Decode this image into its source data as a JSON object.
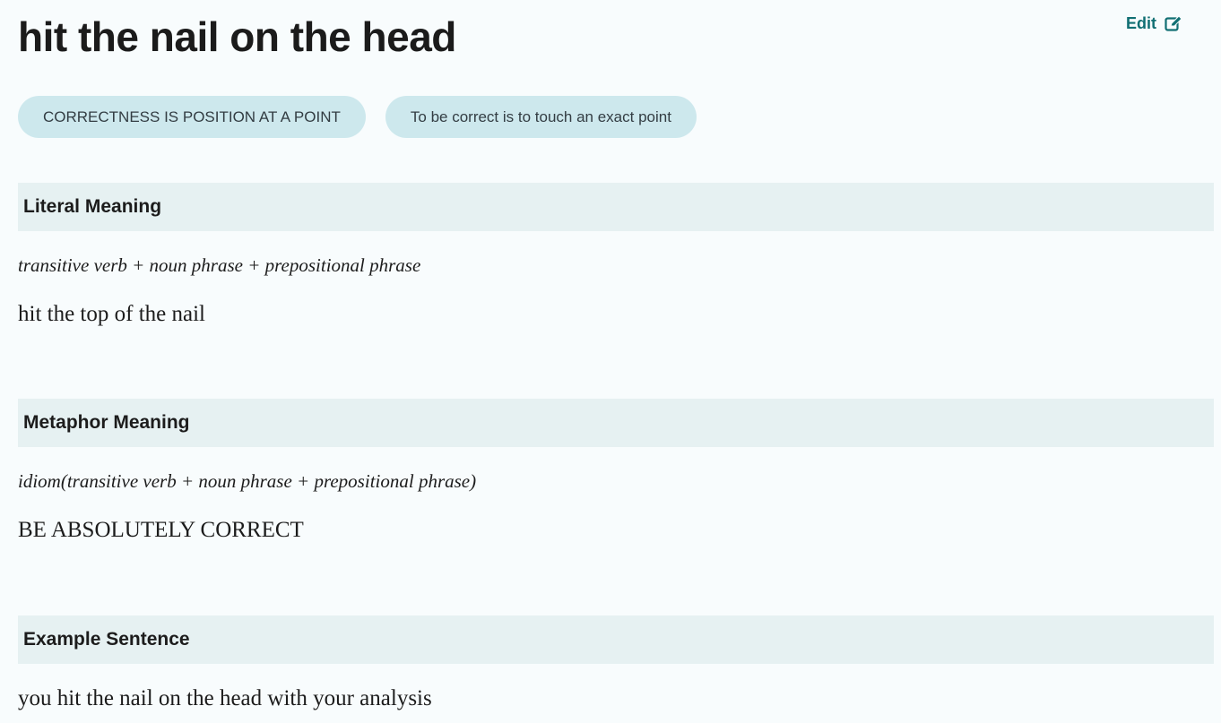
{
  "title": "hit the nail on the head",
  "edit": {
    "label": "Edit",
    "icon": "edit-icon"
  },
  "tags": [
    "CORRECTNESS IS POSITION AT A POINT",
    "To be correct is to touch an exact point"
  ],
  "sections": {
    "literal": {
      "heading": "Literal Meaning",
      "grammar": "transitive verb + noun phrase + prepositional phrase",
      "text": "hit the top of the nail"
    },
    "metaphor": {
      "heading": "Metaphor Meaning",
      "grammar": "idiom(transitive verb + noun phrase + prepositional phrase)",
      "text": "BE ABSOLUTELY CORRECT"
    },
    "example": {
      "heading": "Example Sentence",
      "text": "you hit the nail on the head with your analysis"
    }
  },
  "colors": {
    "background": "#f8fcfd",
    "accent": "#116f73",
    "tag_background": "#cde8ed",
    "section_header_background": "#e6f1f2"
  }
}
